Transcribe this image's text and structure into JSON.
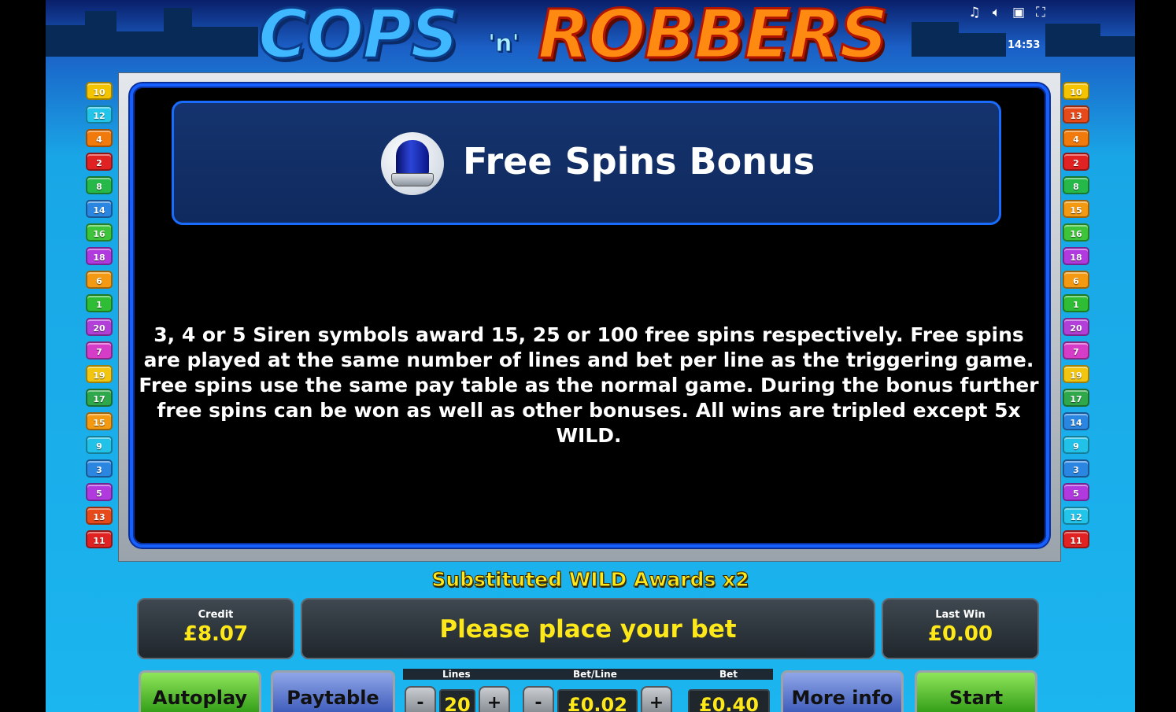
{
  "header": {
    "logo_left": "COPS",
    "logo_middle": "'n'",
    "logo_right": "ROBBERS",
    "clock": "14:53",
    "icons": [
      "music-note-icon",
      "speaker-icon",
      "window-icon",
      "fullscreen-icon"
    ]
  },
  "lines_left": [
    {
      "n": "10",
      "color": "#f5c400"
    },
    {
      "n": "12",
      "color": "#23c4ea"
    },
    {
      "n": "4",
      "color": "#f07a0c"
    },
    {
      "n": "2",
      "color": "#e02222"
    },
    {
      "n": "8",
      "color": "#27b84a"
    },
    {
      "n": "14",
      "color": "#2a86e0"
    },
    {
      "n": "16",
      "color": "#3dc43a"
    },
    {
      "n": "18",
      "color": "#b13adf"
    },
    {
      "n": "6",
      "color": "#f39a12"
    },
    {
      "n": "1",
      "color": "#2fbd35"
    },
    {
      "n": "20",
      "color": "#b23fd8"
    },
    {
      "n": "7",
      "color": "#d53cc8"
    },
    {
      "n": "19",
      "color": "#f2c511"
    },
    {
      "n": "17",
      "color": "#2ea84a"
    },
    {
      "n": "15",
      "color": "#f39a12"
    },
    {
      "n": "9",
      "color": "#22c2e8"
    },
    {
      "n": "3",
      "color": "#2a86e0"
    },
    {
      "n": "5",
      "color": "#b13adf"
    },
    {
      "n": "13",
      "color": "#e64a1a"
    },
    {
      "n": "11",
      "color": "#e02222"
    }
  ],
  "lines_right": [
    {
      "n": "10",
      "color": "#f5c400"
    },
    {
      "n": "13",
      "color": "#e64a1a"
    },
    {
      "n": "4",
      "color": "#f07a0c"
    },
    {
      "n": "2",
      "color": "#e02222"
    },
    {
      "n": "8",
      "color": "#27b84a"
    },
    {
      "n": "15",
      "color": "#f39a12"
    },
    {
      "n": "16",
      "color": "#3dc43a"
    },
    {
      "n": "18",
      "color": "#b13adf"
    },
    {
      "n": "6",
      "color": "#f39a12"
    },
    {
      "n": "1",
      "color": "#2fbd35"
    },
    {
      "n": "20",
      "color": "#b23fd8"
    },
    {
      "n": "7",
      "color": "#d53cc8"
    },
    {
      "n": "19",
      "color": "#f2c511"
    },
    {
      "n": "17",
      "color": "#2ea84a"
    },
    {
      "n": "14",
      "color": "#2a86e0"
    },
    {
      "n": "9",
      "color": "#22c2e8"
    },
    {
      "n": "3",
      "color": "#2a86e0"
    },
    {
      "n": "5",
      "color": "#b13adf"
    },
    {
      "n": "12",
      "color": "#23c4ea"
    },
    {
      "n": "11",
      "color": "#e02222"
    }
  ],
  "info": {
    "title": "Free Spins Bonus",
    "icon": "siren-icon",
    "body": "3, 4 or 5 Siren symbols award 15, 25 or 100 free spins respectively. Free spins are played at the same number of lines and bet per line as the triggering game. Free spins use the same pay table as the normal game. During the bonus further free spins can be won as well as other bonuses. All wins are tripled except 5x WILD."
  },
  "status": {
    "wild_message": "Substituted WILD Awards x2",
    "credit_label": "Credit",
    "credit_value": "£8.07",
    "message": "Please place your bet",
    "last_win_label": "Last Win",
    "last_win_value": "£0.00"
  },
  "controls": {
    "autoplay": "Autoplay",
    "paytable": "Paytable",
    "more_info": "More info",
    "start": "Start",
    "lines_label": "Lines",
    "lines_value": "20",
    "bet_line_label": "Bet/Line",
    "bet_line_value": "£0.02",
    "bet_label": "Bet",
    "bet_value": "£0.40",
    "minus": "-",
    "plus": "+"
  }
}
